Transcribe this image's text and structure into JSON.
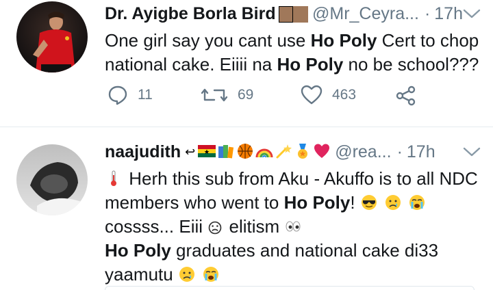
{
  "tweets": [
    {
      "author_name": "Dr. Ayigbe Borla Bird",
      "handle": "@Mr_Ceyra...",
      "time": "17h",
      "text_parts": [
        "One girl say you cant use ",
        "Ho Poly",
        " Cert to chop national cake. Eiiii na ",
        "Ho Poly",
        " no be school???"
      ],
      "replies": "11",
      "retweets": "69",
      "likes": "463"
    },
    {
      "author_name": "naajudith",
      "handle": "@rea...",
      "time": "17h",
      "line1": "Herh this sub from Aku - Akuffo is to all NDC",
      "line2_a": "members who went to ",
      "line2_b": "Ho Poly",
      "line2_c": "!",
      "line3": "cossss... Eiii",
      "line3_b": " elitism",
      "line4_a": "Ho Poly",
      "line4_b": " graduates and national cake di33",
      "line5": "yaamutu"
    }
  ],
  "icons": [
    "reply-icon",
    "retweet-icon",
    "like-icon",
    "share-icon",
    "caret-down-icon"
  ],
  "colors": {
    "text": "#14171a",
    "muted": "#657786",
    "divider": "#e6ecf0"
  }
}
